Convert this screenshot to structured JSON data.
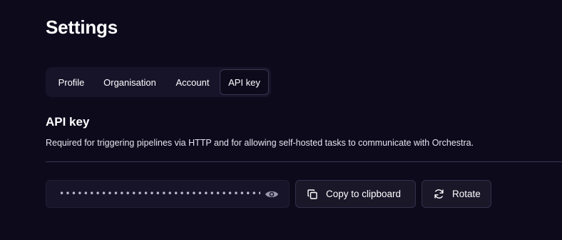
{
  "page": {
    "title": "Settings"
  },
  "tabs": [
    {
      "label": "Profile",
      "active": false
    },
    {
      "label": "Organisation",
      "active": false
    },
    {
      "label": "Account",
      "active": false
    },
    {
      "label": "API key",
      "active": true
    }
  ],
  "api_key_section": {
    "title": "API key",
    "description": "Required for triggering pipelines via HTTP and for allowing self-hosted tasks to communicate with Orchestra.",
    "masked_value": "••••••••••••••••••••••••••••••••••••••••••••••••",
    "reveal_icon": "eye-icon",
    "copy_button": {
      "label": "Copy to clipboard",
      "icon": "copy-icon"
    },
    "rotate_button": {
      "label": "Rotate",
      "icon": "refresh-icon"
    }
  },
  "colors": {
    "background": "#0d0a1c",
    "surface": "#17142a",
    "border": "#3a3650",
    "text": "#ffffff",
    "muted_text": "#bdbad0"
  }
}
